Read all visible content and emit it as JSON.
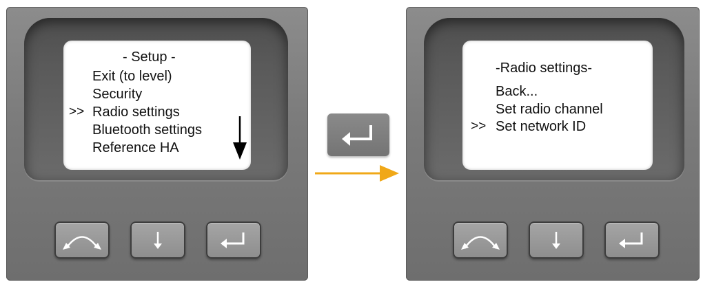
{
  "left_panel": {
    "screen": {
      "title": "- Setup -",
      "cursor": ">>",
      "items": [
        "Exit (to level)",
        "Security",
        "Radio settings",
        "Bluetooth settings",
        "Reference HA"
      ],
      "selected_index": 2,
      "scroll_indicator": "down-arrow-icon"
    },
    "buttons": [
      "curved-arrow-icon",
      "down-arrow-icon",
      "enter-icon"
    ]
  },
  "transition": {
    "key": "enter-icon",
    "arrow": "right-arrow-icon",
    "arrow_color": "#f0a818"
  },
  "right_panel": {
    "screen": {
      "title": "-Radio settings-",
      "cursor": ">>",
      "items": [
        "Back...",
        "Set radio channel",
        "Set network ID"
      ],
      "selected_index": 2
    },
    "buttons": [
      "curved-arrow-icon",
      "down-arrow-icon",
      "enter-icon"
    ]
  }
}
